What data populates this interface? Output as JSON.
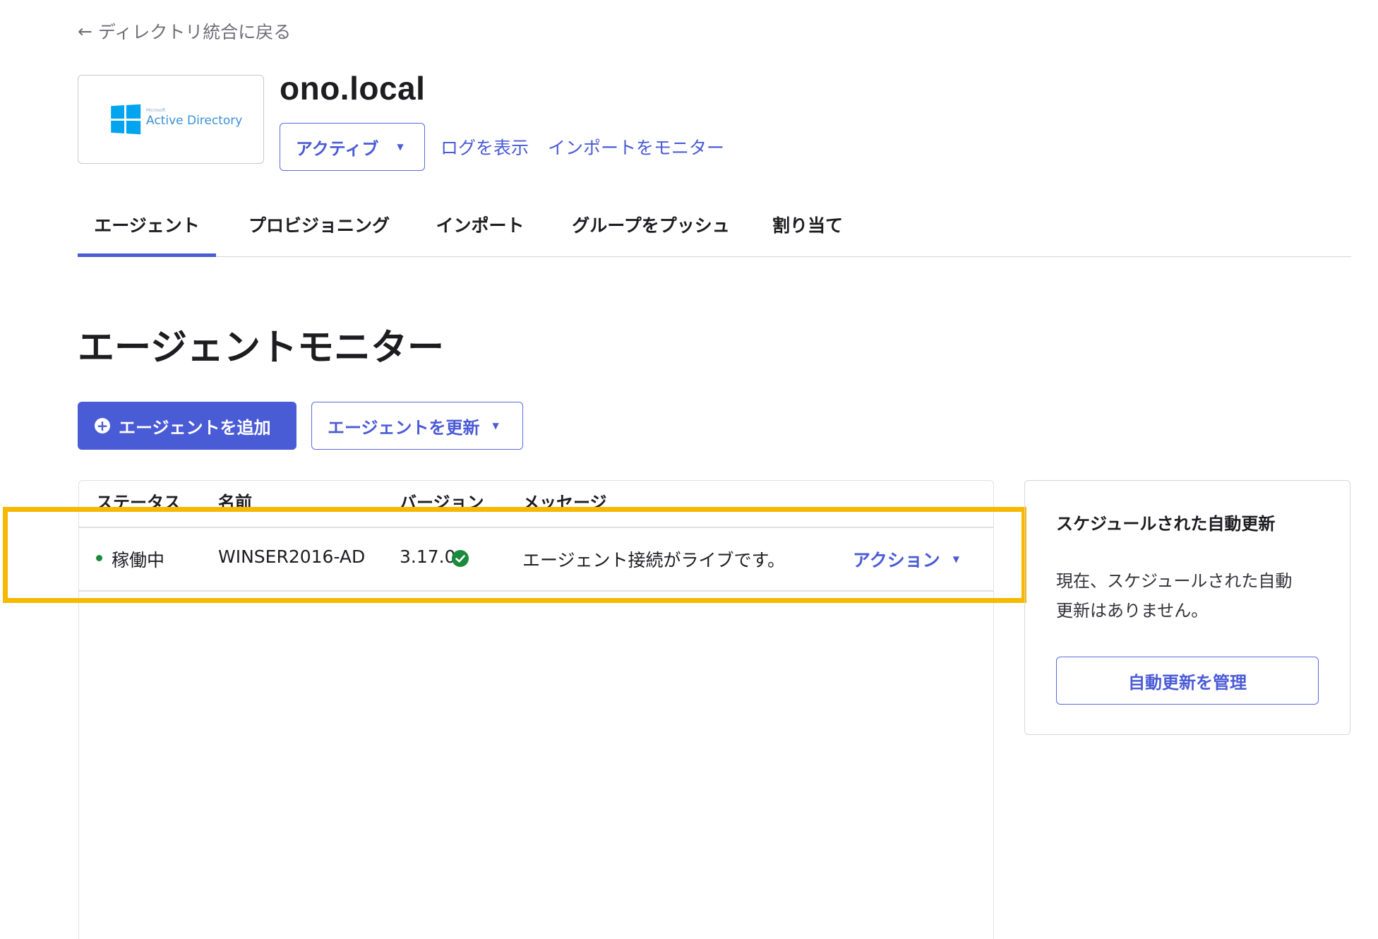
{
  "nav": {
    "back_label": "ディレクトリ統合に戻る"
  },
  "integration": {
    "logo_text": "Active Directory",
    "logo_brand": "Microsoft",
    "title": "ono.local",
    "status_label": "アクティブ",
    "view_logs_label": "ログを表示",
    "monitor_imports_label": "インポートをモニター"
  },
  "tabs": [
    {
      "label": "エージェント",
      "active": true
    },
    {
      "label": "プロビジョニング",
      "active": false
    },
    {
      "label": "インポート",
      "active": false
    },
    {
      "label": "グループをプッシュ",
      "active": false
    },
    {
      "label": "割り当て",
      "active": false
    }
  ],
  "section": {
    "title": "エージェントモニター",
    "add_agent_label": "エージェントを追加",
    "update_agent_label": "エージェントを更新"
  },
  "table": {
    "headers": [
      "ステータス",
      "名前",
      "バージョン",
      "メッセージ"
    ],
    "rows": [
      {
        "status": "稼働中",
        "name": "WINSER2016-AD",
        "version": "3.17.0",
        "message": "エージェント接続がライブです。",
        "action_label": "アクション"
      }
    ]
  },
  "side_panel": {
    "title": "スケジュールされた自動更新",
    "text": "現在、スケジュールされた自動更新はありません。",
    "manage_label": "自動更新を管理"
  },
  "colors": {
    "accent": "#4a5bd6",
    "status_ok": "#1a8a3c",
    "highlight": "#f6b800"
  }
}
